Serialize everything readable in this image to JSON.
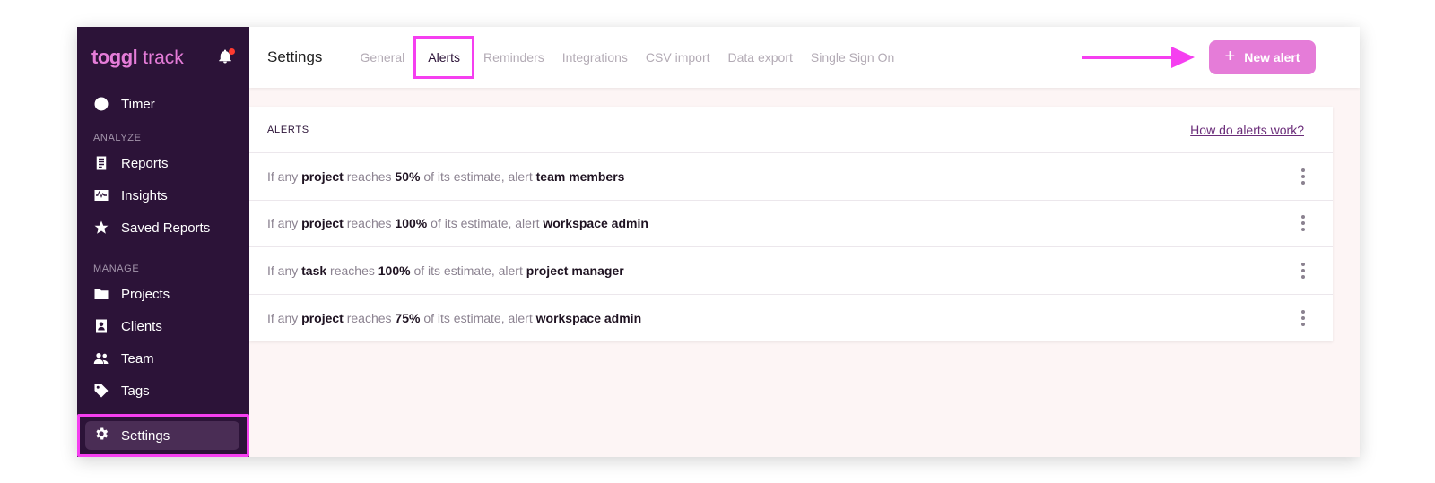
{
  "app": {
    "logo_word": "toggl",
    "logo_suffix": "track"
  },
  "sidebar": {
    "top_item": {
      "label": "Timer",
      "icon": "clock-icon"
    },
    "sections": [
      {
        "title": "ANALYZE",
        "items": [
          {
            "label": "Reports",
            "icon": "report-icon"
          },
          {
            "label": "Insights",
            "icon": "insights-icon"
          },
          {
            "label": "Saved Reports",
            "icon": "star-icon"
          }
        ]
      },
      {
        "title": "MANAGE",
        "items": [
          {
            "label": "Projects",
            "icon": "folder-icon"
          },
          {
            "label": "Clients",
            "icon": "client-icon"
          },
          {
            "label": "Team",
            "icon": "team-icon"
          },
          {
            "label": "Tags",
            "icon": "tag-icon"
          }
        ]
      }
    ],
    "settings": {
      "label": "Settings",
      "icon": "gear-icon"
    }
  },
  "header": {
    "title": "Settings",
    "tabs": [
      "General",
      "Alerts",
      "Reminders",
      "Integrations",
      "CSV import",
      "Data export",
      "Single Sign On"
    ],
    "active_tab": "Alerts",
    "new_alert_label": "New alert"
  },
  "alerts": {
    "heading": "ALERTS",
    "help_link": "How do alerts work?",
    "rows": [
      {
        "p1": "If any ",
        "entity": "project",
        "p2": " reaches ",
        "pct": "50%",
        "p3": " of its estimate, alert ",
        "target": "team members"
      },
      {
        "p1": "If any ",
        "entity": "project",
        "p2": " reaches ",
        "pct": "100%",
        "p3": " of its estimate, alert ",
        "target": "workspace admin"
      },
      {
        "p1": "If any ",
        "entity": "task",
        "p2": " reaches ",
        "pct": "100%",
        "p3": " of its estimate, alert ",
        "target": "project manager"
      },
      {
        "p1": "If any ",
        "entity": "project",
        "p2": " reaches ",
        "pct": "75%",
        "p3": " of its estimate, alert ",
        "target": "workspace admin"
      }
    ]
  },
  "colors": {
    "sidebar_bg": "#2c1338",
    "accent_pink": "#e57cd8",
    "highlight_magenta": "#f53ff0"
  }
}
